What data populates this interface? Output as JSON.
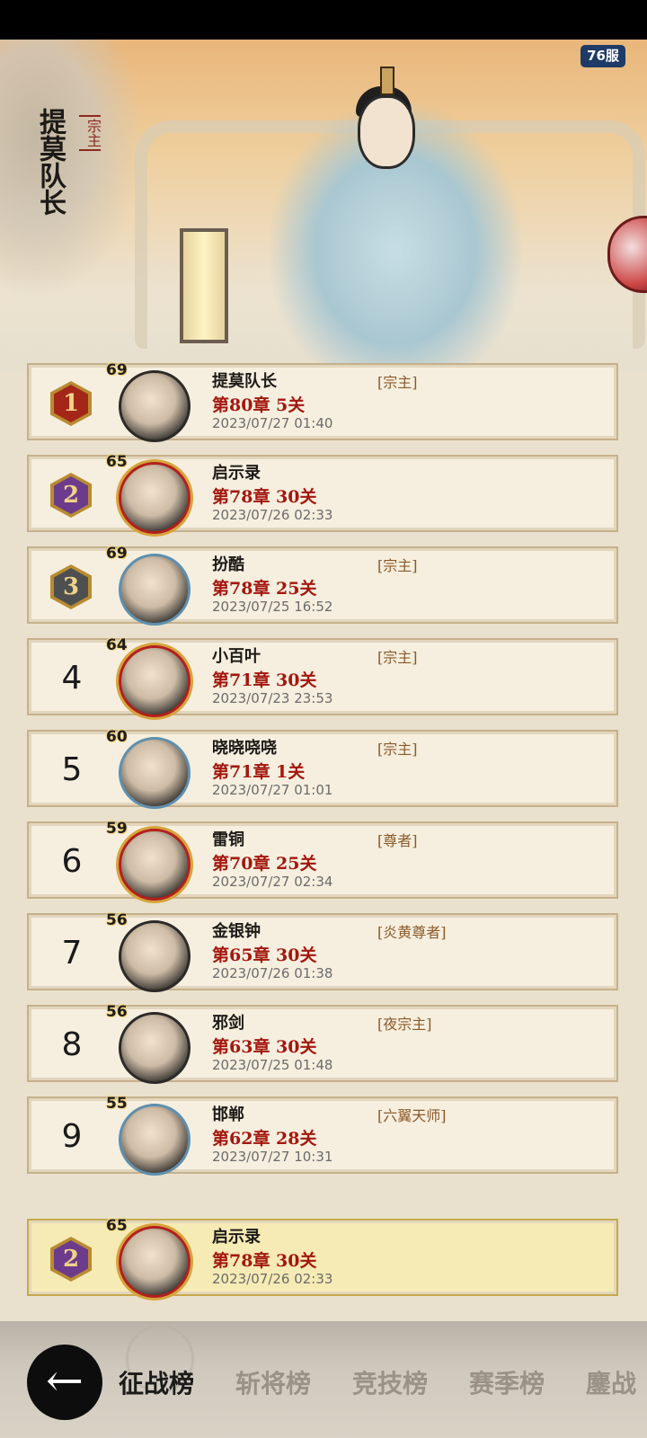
{
  "hero": {
    "name": "提莫队长",
    "title": "宗主"
  },
  "server_badge": "76服",
  "rankings": [
    {
      "rank": "1",
      "level": "69",
      "name": "提莫队长",
      "title": "[宗主]",
      "stage": "第80章 5关",
      "date": "2023/07/27 01:40"
    },
    {
      "rank": "2",
      "level": "65",
      "name": "启示录",
      "title": "",
      "stage": "第78章 30关",
      "date": "2023/07/26 02:33"
    },
    {
      "rank": "3",
      "level": "69",
      "name": "扮酷",
      "title": "[宗主]",
      "stage": "第78章 25关",
      "date": "2023/07/25 16:52"
    },
    {
      "rank": "4",
      "level": "64",
      "name": "小百叶",
      "title": "[宗主]",
      "stage": "第71章 30关",
      "date": "2023/07/23 23:53"
    },
    {
      "rank": "5",
      "level": "60",
      "name": "晓晓哓哓",
      "title": "[宗主]",
      "stage": "第71章 1关",
      "date": "2023/07/27 01:01"
    },
    {
      "rank": "6",
      "level": "59",
      "name": "雷铜",
      "title": "[尊者]",
      "stage": "第70章 25关",
      "date": "2023/07/27 02:34"
    },
    {
      "rank": "7",
      "level": "56",
      "name": "金银钟",
      "title": "[炎黄尊者]",
      "stage": "第65章 30关",
      "date": "2023/07/26 01:38"
    },
    {
      "rank": "8",
      "level": "56",
      "name": "邪剑",
      "title": "[夜宗主]",
      "stage": "第63章 30关",
      "date": "2023/07/25 01:48"
    },
    {
      "rank": "9",
      "level": "55",
      "name": "邯郸",
      "title": "[六翼天师]",
      "stage": "第62章 28关",
      "date": "2023/07/27 10:31"
    }
  ],
  "my_rank": {
    "rank": "2",
    "level": "65",
    "name": "启示录",
    "title": "",
    "stage": "第78章 30关",
    "date": "2023/07/26 02:33"
  },
  "tabs": [
    "征战榜",
    "斩将榜",
    "竞技榜",
    "赛季榜",
    "鏖战"
  ],
  "icons": {
    "back": "back-arrow-icon"
  }
}
